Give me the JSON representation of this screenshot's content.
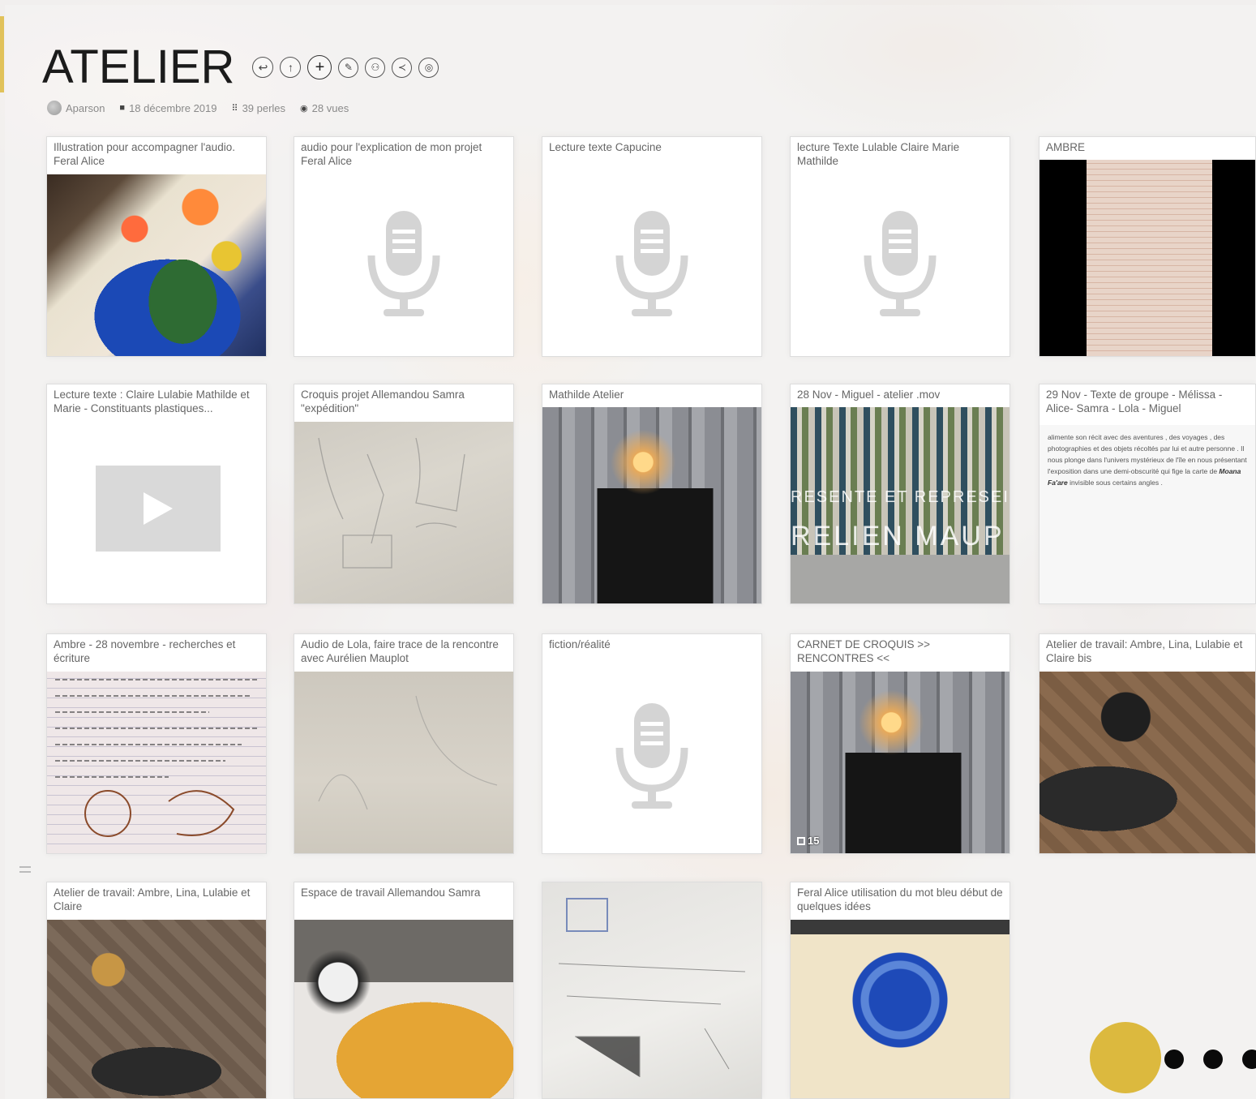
{
  "header": {
    "title": "ATELIER",
    "toolbar": [
      {
        "icon": "back-arrow-icon",
        "glyph": "↩"
      },
      {
        "icon": "upload-icon",
        "glyph": "↑"
      },
      {
        "icon": "add-icon",
        "glyph": "+"
      },
      {
        "icon": "edit-icon",
        "glyph": "✎"
      },
      {
        "icon": "people-icon",
        "glyph": "⚇"
      },
      {
        "icon": "share-icon",
        "glyph": "≺"
      },
      {
        "icon": "settings-icon",
        "glyph": "◎"
      }
    ]
  },
  "meta": {
    "author": "Aparson",
    "date": "18 décembre 2019",
    "pearls": "39 perles",
    "views": "28 vues"
  },
  "cards": [
    {
      "title": "Illustration pour accompagner l'audio. Feral Alice",
      "type": "image"
    },
    {
      "title": "audio pour l'explication de mon projet Feral Alice",
      "type": "audio"
    },
    {
      "title": "Lecture texte Capucine",
      "type": "audio"
    },
    {
      "title": "lecture Texte Lulable Claire Marie Mathilde",
      "type": "audio"
    },
    {
      "title": "AMBRE",
      "type": "image"
    },
    {
      "title": "Lecture texte : Claire Lulabie Mathilde et Marie - Constituants plastiques...",
      "type": "video"
    },
    {
      "title": "Croquis projet Allemandou Samra \"expédition\"",
      "type": "image"
    },
    {
      "title": "Mathilde Atelier",
      "type": "image"
    },
    {
      "title": "28 Nov - Miguel - atelier .mov",
      "type": "image",
      "overlay1": "RESENTE ET REPRESEI",
      "overlay2": "RELIEN MAUP"
    },
    {
      "title": "29 Nov - Texte de groupe - Mélissa - Alice- Samra - Lola - Miguel",
      "type": "text",
      "excerpt_a": "alimente son récit avec des aventures , des voyages , des photographies et des objets récoltés par lui et autre personne . Il nous plonge dans l'univers mystérieux de l'île en nous présentant l'exposition dans une demi-obscurité qui fige la carte de ",
      "excerpt_em": "Moana Fa'are",
      "excerpt_b": " invisible sous certains angles ."
    },
    {
      "title": "Ambre - 28 novembre - recherches et écriture",
      "type": "image"
    },
    {
      "title": "Audio de Lola, faire trace de la rencontre avec Aurélien Mauplot",
      "type": "image"
    },
    {
      "title": "fiction/réalité",
      "type": "audio"
    },
    {
      "title": "CARNET DE CROQUIS >> RENCONTRES <<",
      "type": "image",
      "badge": "15"
    },
    {
      "title": "Atelier de travail: Ambre, Lina, Lulabie et Claire bis",
      "type": "image"
    },
    {
      "title": "Atelier de travail: Ambre, Lina, Lulabie et Claire",
      "type": "image"
    },
    {
      "title": "Espace de travail Allemandou Samra",
      "type": "image"
    },
    {
      "title": "",
      "type": "image"
    },
    {
      "title": "Feral Alice utilisation du mot bleu début de quelques idées",
      "type": "image"
    }
  ],
  "colors": {
    "accent": "#dcb93e",
    "placeholder_icon": "#d4d4d4"
  }
}
